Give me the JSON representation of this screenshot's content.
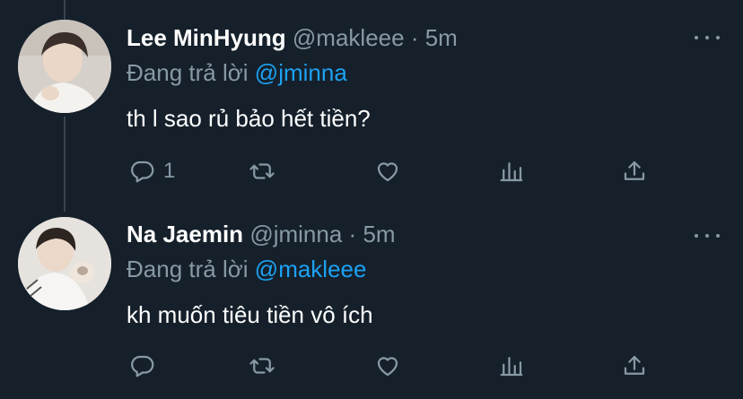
{
  "tweets": [
    {
      "name": "Lee MinHyung",
      "handle": "@makleee",
      "separator": "·",
      "time": "5m",
      "reply_prefix": "Đang trả lời",
      "reply_to": "@jminna",
      "text": "th l sao rủ bảo hết tiền?",
      "reply_count": "1"
    },
    {
      "name": "Na Jaemin",
      "handle": "@jminna",
      "separator": "·",
      "time": "5m",
      "reply_prefix": "Đang trả lời",
      "reply_to": "@makleee",
      "text": "kh muốn tiêu tiền vô ích",
      "reply_count": ""
    }
  ],
  "theme": {
    "background": "#15202b",
    "text": "#ffffff",
    "muted": "#8899a6",
    "link": "#1da1f2",
    "thread_line": "#38444d"
  },
  "icons": [
    "reply-icon",
    "retweet-icon",
    "like-icon",
    "stats-icon",
    "share-icon",
    "more-icon"
  ]
}
